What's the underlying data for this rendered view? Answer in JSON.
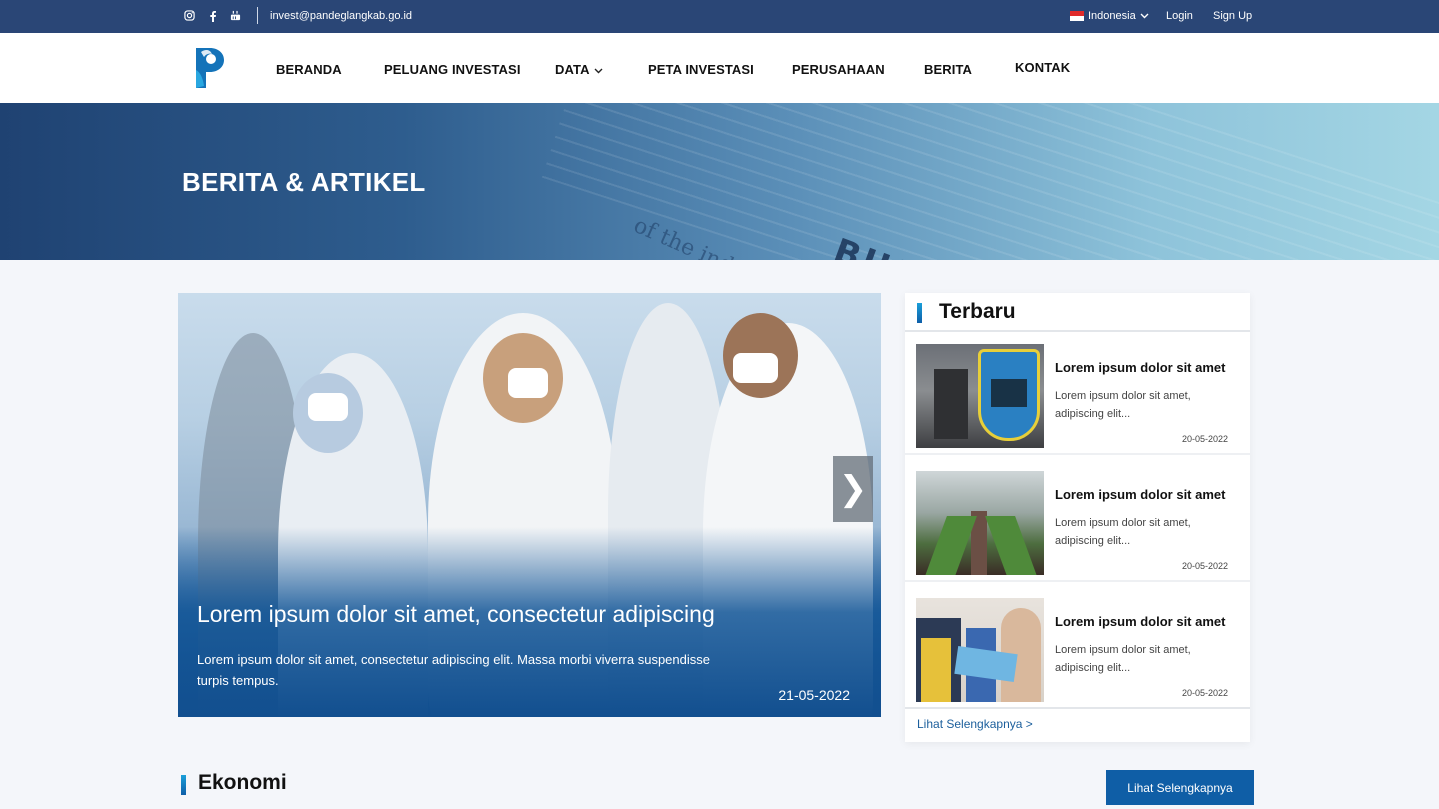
{
  "topbar": {
    "email": "invest@pandeglangkab.go.id",
    "language": "Indonesia",
    "login": "Login",
    "signup": "Sign Up",
    "social_icons": [
      "instagram-icon",
      "facebook-icon",
      "youtube-icon"
    ]
  },
  "nav": {
    "items": [
      "BERANDA",
      "PELUANG INVESTASI",
      "DATA",
      "PETA INVESTASI",
      "PERUSAHAAN",
      "BERITA",
      "KONTAK"
    ]
  },
  "hero": {
    "title": "BERITA & ARTIKEL",
    "bg_word": "BUSINESS",
    "bg_word2": "of the indicative"
  },
  "featured": {
    "title": "Lorem ipsum dolor sit amet, consectetur adipiscing",
    "description": "Lorem ipsum dolor sit amet, consectetur adipiscing elit. Massa morbi viverra suspendisse turpis tempus.",
    "date": "21-05-2022",
    "next_glyph": "❯"
  },
  "latest": {
    "heading": "Terbaru",
    "items": [
      {
        "title": "Lorem ipsum dolor sit amet",
        "description": "Lorem ipsum dolor sit amet, adipiscing elit...",
        "date": "20-05-2022"
      },
      {
        "title": "Lorem ipsum dolor sit amet",
        "description": "Lorem ipsum dolor sit amet, adipiscing elit...",
        "date": "20-05-2022"
      },
      {
        "title": "Lorem ipsum dolor sit amet",
        "description": "Lorem ipsum dolor sit amet, adipiscing elit...",
        "date": "20-05-2022"
      }
    ],
    "more": "Lihat Selengkapnya >"
  },
  "section": {
    "title": "Ekonomi",
    "button": "Lihat Selengkapnya"
  },
  "colors": {
    "topbar": "#2a4676",
    "accent": "#0f5ea6",
    "link": "#1c5f9c"
  }
}
